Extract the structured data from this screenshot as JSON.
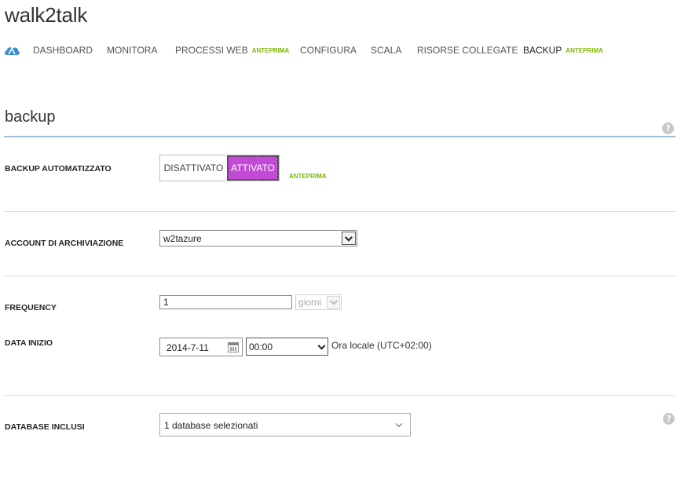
{
  "app": {
    "title": "walk2talk"
  },
  "nav": {
    "logo_icon": "cloud-website-icon",
    "items": [
      {
        "label": "DASHBOARD",
        "badge": ""
      },
      {
        "label": "MONITORA",
        "badge": ""
      },
      {
        "label": "PROCESSI WEB",
        "badge": "ANTEPRIMA"
      },
      {
        "label": "CONFIGURA",
        "badge": ""
      },
      {
        "label": "SCALA",
        "badge": ""
      },
      {
        "label": "RISORSE COLLEGATE",
        "badge": ""
      },
      {
        "label": "BACKUP",
        "badge": "ANTEPRIMA",
        "active": true
      }
    ]
  },
  "section": {
    "title": "backup",
    "help": "?"
  },
  "form": {
    "backup_auto": {
      "label": "BACKUP AUTOMATIZZATO",
      "off_label": "DISATTIVATO",
      "on_label": "ATTIVATO",
      "selected": "ATTIVATO",
      "badge": "ANTEPRIMA"
    },
    "storage": {
      "label": "ACCOUNT DI ARCHIVIAZIONE",
      "value": "w2tazure"
    },
    "frequency": {
      "label": "FREQUENCY",
      "value": "1",
      "unit": "giorni"
    },
    "start": {
      "label": "DATA INIZIO",
      "date": "2014-7-11",
      "time": "00:00",
      "timezone": "Ora locale (UTC+02:00)"
    },
    "databases": {
      "label": "DATABASE INCLUSI",
      "value": "1 database selezionati",
      "help": "?"
    }
  },
  "colors": {
    "accent_on": "#c24bd6",
    "badge_green": "#7cb800",
    "section_line": "#9fbfd8"
  }
}
